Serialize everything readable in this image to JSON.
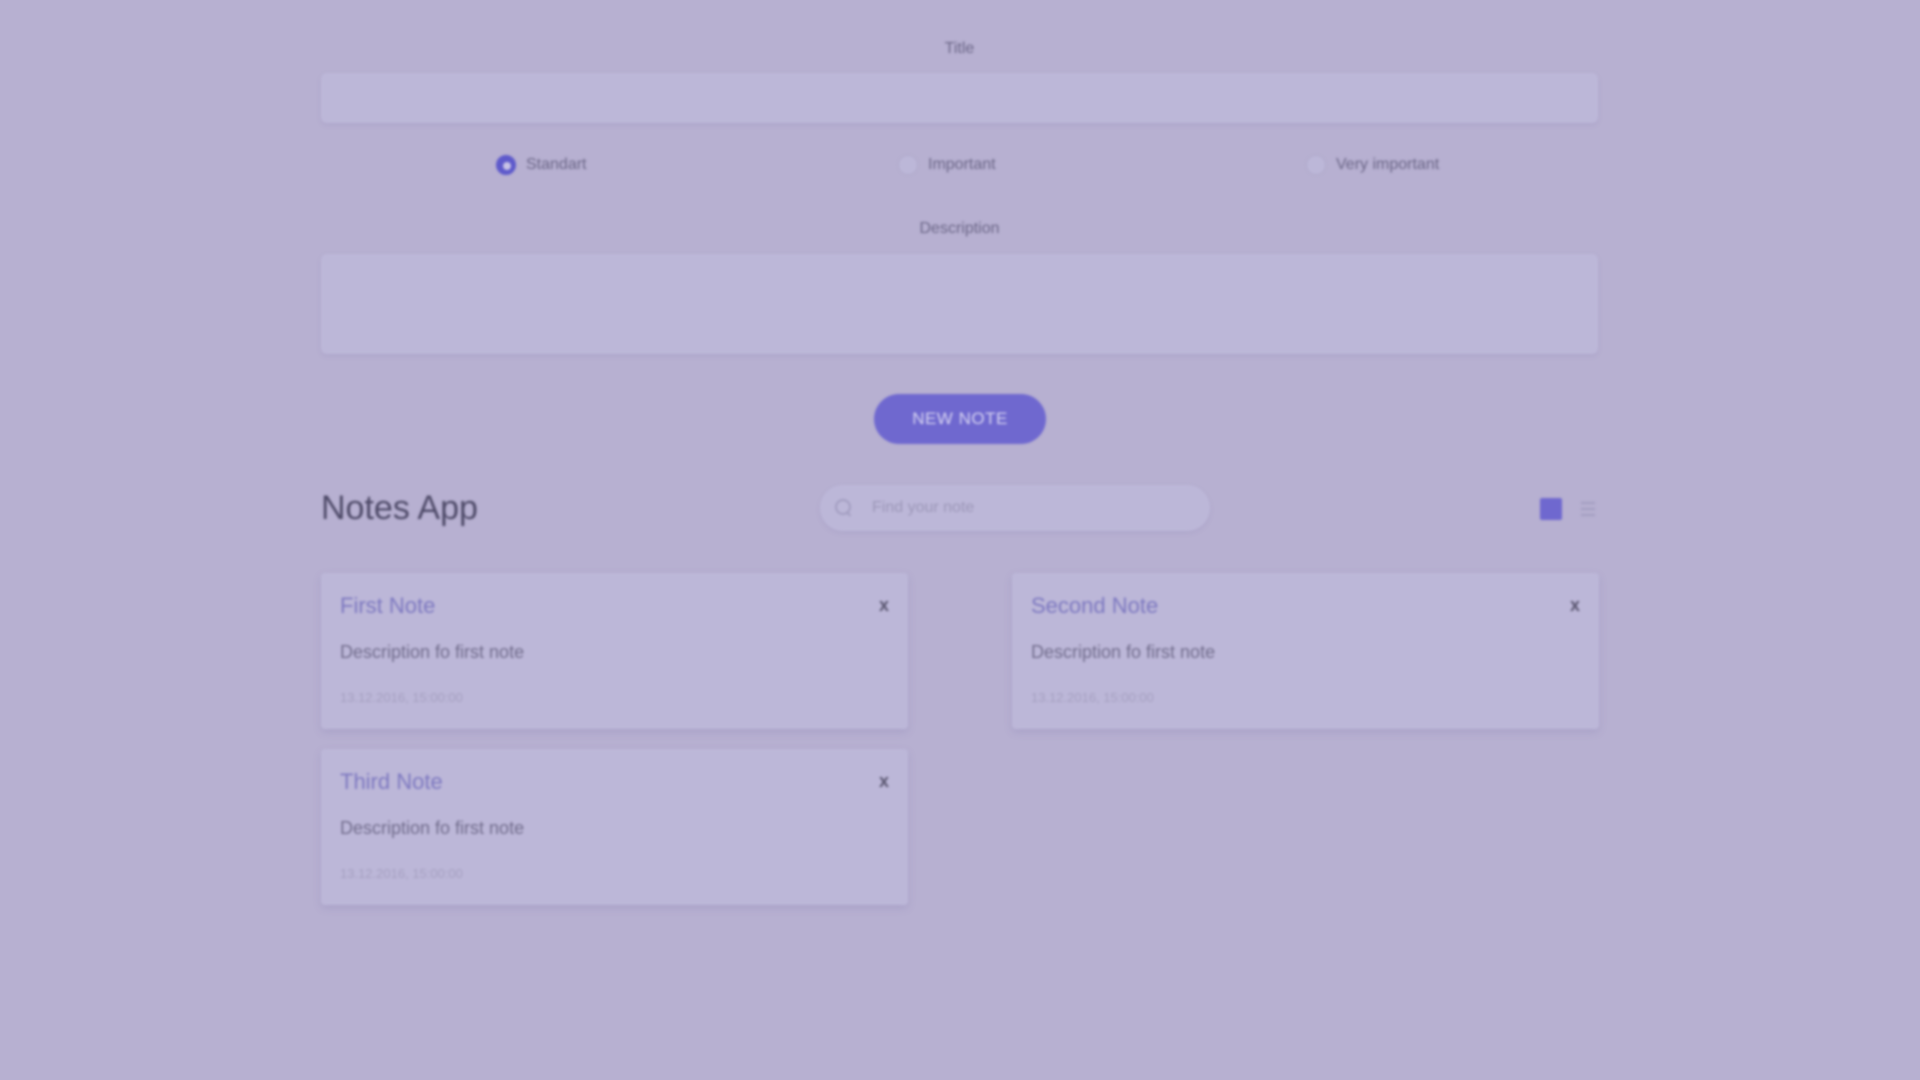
{
  "form": {
    "title_label": "Title",
    "title_value": "",
    "priority_options": [
      {
        "label": "Standart",
        "checked": true
      },
      {
        "label": "Important",
        "checked": false
      },
      {
        "label": "Very important",
        "checked": false
      }
    ],
    "description_label": "Description",
    "description_value": "",
    "new_note_label": "NEW NOTE"
  },
  "header": {
    "app_title": "Notes App",
    "search_placeholder": "Find your note",
    "view_mode": "grid"
  },
  "notes": [
    {
      "title": "First Note",
      "description": "Description fo first note",
      "date": "13.12.2016, 15:00:00",
      "close_label": "x"
    },
    {
      "title": "Second Note",
      "description": "Description fo first note",
      "date": "13.12.2016, 15:00:00",
      "close_label": "x"
    },
    {
      "title": "Third Note",
      "description": "Description fo first note",
      "date": "13.12.2016, 15:00:00",
      "close_label": "x"
    }
  ],
  "colors": {
    "background": "#b7b0d1",
    "accent": "#6f68cf",
    "card": "#bcb7d8"
  },
  "icons": {
    "search": "search-icon",
    "grid_view": "grid-view-icon",
    "list_view": "list-view-icon"
  }
}
